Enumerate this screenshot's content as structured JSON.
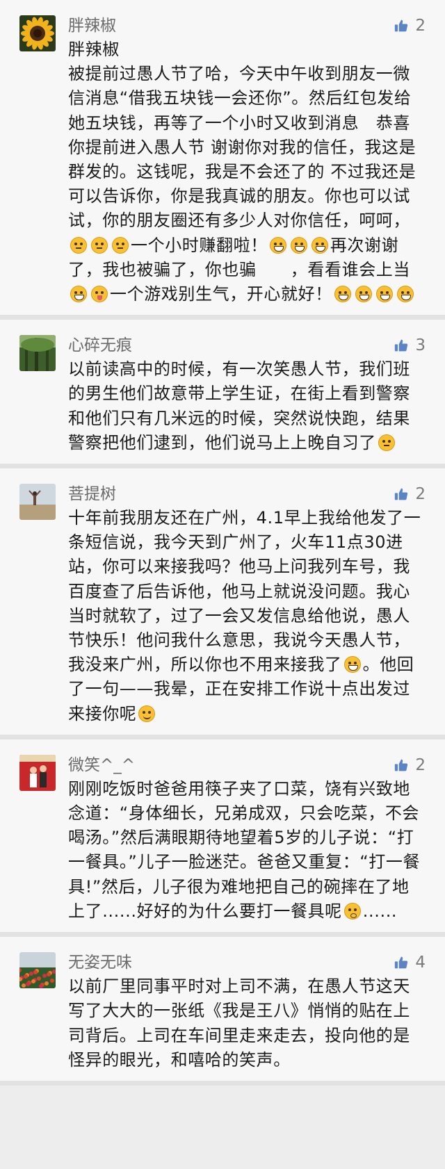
{
  "comments": [
    {
      "username": "胖辣椒",
      "likes": "2",
      "avatar": "sunflower",
      "body": [
        {
          "t": "胖辣椒\n被提前过愚人节了哈，今天中午收到朋友一微信消息“借我五块钱一会还你”。然后红包发给她五块钱，再等了一个小时又收到消息　恭喜你提前进入愚人节 谢谢你对我的信任，我这是群发的。这钱呢，我是不会还了的 不过我还是可以告诉你，你是我真诚的朋友。你也可以试试，你的朋友圈还有多少人对你信任，呵呵，"
        },
        {
          "e": "think"
        },
        {
          "e": "think"
        },
        {
          "e": "think"
        },
        {
          "t": "一个小时赚翻啦！"
        },
        {
          "e": "grin"
        },
        {
          "e": "grin"
        },
        {
          "e": "grin"
        },
        {
          "t": "再次谢谢了，我也被骗了，你也骗　　，看看谁会上当"
        },
        {
          "e": "grin"
        },
        {
          "e": "tongue"
        },
        {
          "t": "一个游戏别生气，开心就好！"
        },
        {
          "e": "grin"
        },
        {
          "e": "grin"
        },
        {
          "e": "grin"
        },
        {
          "e": "grin"
        }
      ]
    },
    {
      "username": "心碎无痕",
      "likes": "3",
      "avatar": "forest",
      "body": [
        {
          "t": "以前读高中的时候，有一次笑愚人节，我们班的男生他们故意带上学生证，在街上看到警察和他们只有几米远的时候，突然说快跑，结果警察把他们逮到，他们说马上上晚自习了"
        },
        {
          "e": "think"
        }
      ]
    },
    {
      "username": "菩提树",
      "likes": "2",
      "avatar": "beach",
      "body": [
        {
          "t": "十年前我朋友还在广州，4.1早上我给他发了一条短信说，我今天到广州了，火车11点30进站，你可以来接我吗？他马上问我列车号，我百度查了后告诉他，他马上就说没问题。我心当时就软了，过了一会又发信息给他说，愚人节快乐！他问我什么意思，我说今天愚人节，我没来广州，所以你也不用来接我了"
        },
        {
          "e": "grin"
        },
        {
          "t": "。他回了一句——我晕，正在安排工作说十点出发过来接你呢"
        },
        {
          "e": "smirk"
        }
      ]
    },
    {
      "username": "微笑^_^",
      "likes": "2",
      "avatar": "red",
      "body": [
        {
          "t": "刚刚吃饭时爸爸用筷子夹了口菜，饶有兴致地念道：“身体细长，兄弟成双，只会吃菜，不会喝汤。”然后满眼期待地望着5岁的儿子说：“打一餐具。”儿子一脸迷茫。爸爸又重复：“打一餐具!”然后，儿子很为难地把自己的碗摔在了地上了......好好的为什么要打一餐具呢"
        },
        {
          "e": "dizzy"
        },
        {
          "t": "......"
        }
      ]
    },
    {
      "username": "无姿无味",
      "likes": "4",
      "avatar": "flowers",
      "body": [
        {
          "t": "以前厂里同事平时对上司不满，在愚人节这天写了大大的一张纸《我是王八》悄悄的贴在上司背后。上司在车间里走来走去，投向他的是怪异的眼光，和嘻哈的笑声。"
        }
      ]
    }
  ],
  "colors": {
    "background": "#f7f7f7",
    "name": "#6b6b6b",
    "like_icon": "#5a84c4",
    "body_text": "#1a1a1a"
  },
  "icons": [
    "thumbs-up-icon",
    "avatar"
  ]
}
